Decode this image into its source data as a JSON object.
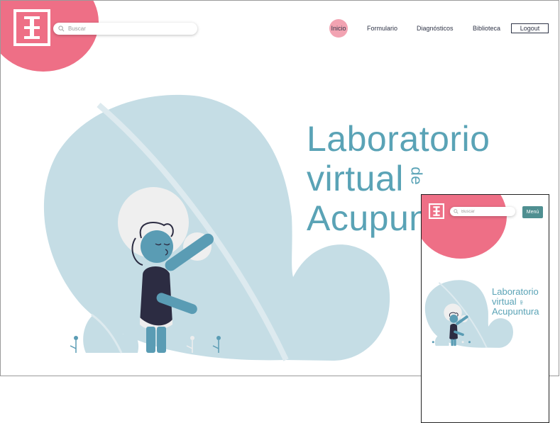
{
  "desktop": {
    "search": {
      "placeholder": "Buscar"
    },
    "nav": {
      "items": [
        "Inicio",
        "Formulario",
        "Diagnósticos",
        "Biblioteca"
      ],
      "active": "Inicio",
      "logout_label": "Logout"
    },
    "hero": {
      "line1": "Laboratorio",
      "line2": "virtual",
      "connector": "de",
      "line3": "Acupuntura"
    }
  },
  "mobile": {
    "search": {
      "placeholder": "Buscar"
    },
    "menu_label": "Menú",
    "hero": {
      "line1": "Laboratorio",
      "line2": "virtual",
      "connector": "de",
      "line3": "Acupuntura"
    }
  },
  "colors": {
    "accent_pink": "#ee6f86",
    "title_teal": "#5aa3b6",
    "leaf_blue": "#c5dde5",
    "figure_teal": "#5a9cb4",
    "figure_navy": "#2c2c42",
    "menu_green": "#4f8f91"
  }
}
